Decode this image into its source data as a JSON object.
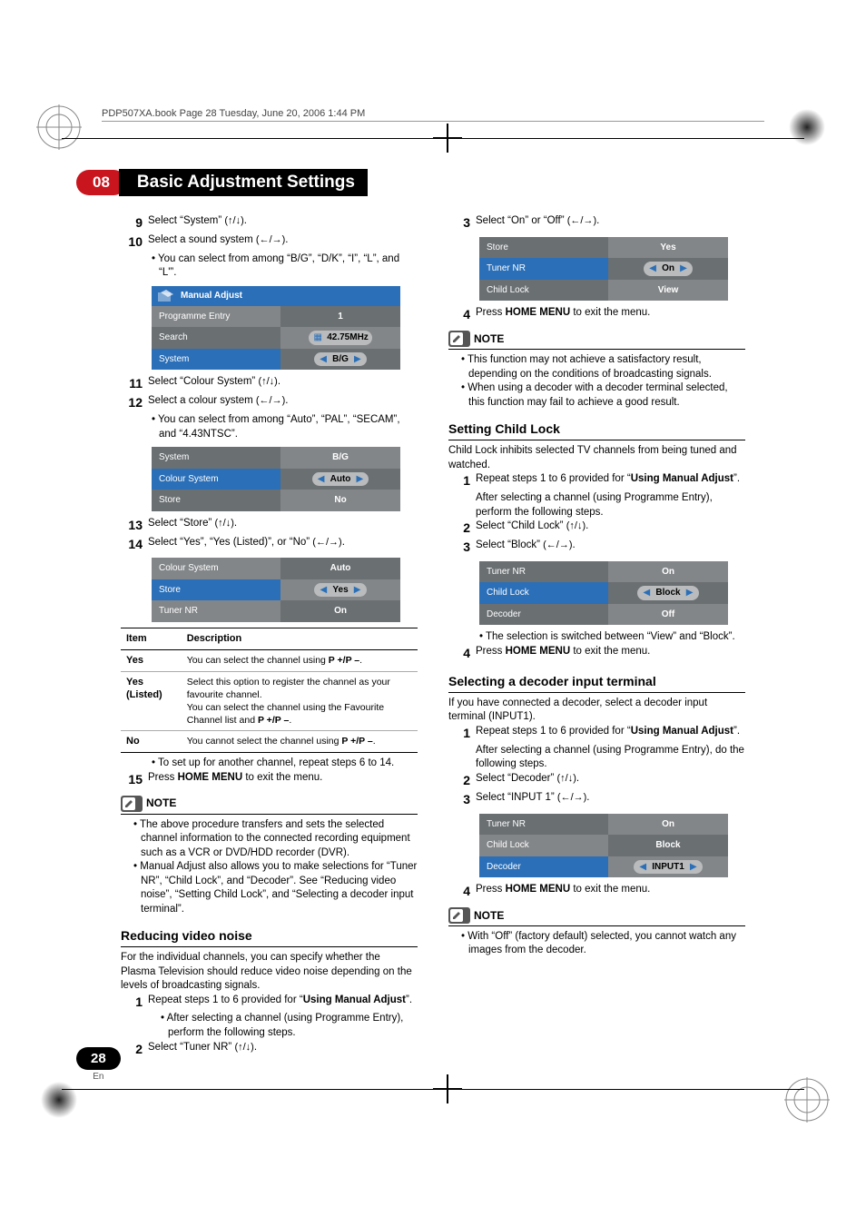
{
  "runhead": "PDP507XA.book  Page 28  Tuesday, June 20, 2006  1:44 PM",
  "chapter": {
    "num": "08",
    "title": "Basic Adjustment Settings"
  },
  "arrows": {
    "updown": "(↑/↓)",
    "leftright": "(←/→)"
  },
  "left": {
    "step9": "Select “System” ",
    "step10": "Select a sound system ",
    "step10_note": "You can select from among “B/G”, “D/K”, “I”, “L”, and “L'”.",
    "menu1": {
      "title": "Manual Adjust",
      "rows": [
        {
          "l": "Programme Entry",
          "r": "1"
        },
        {
          "l": "Search",
          "r": "42.75MHz"
        },
        {
          "l": "System",
          "r": "B/G",
          "hl": true,
          "pill": true
        }
      ]
    },
    "step11": "Select “Colour System” ",
    "step12": "Select a colour system ",
    "step12_note": "You can select from among “Auto”, “PAL”, “SECAM”, and “4.43NTSC”.",
    "menu2": {
      "rows": [
        {
          "l": "System",
          "r": "B/G"
        },
        {
          "l": "Colour System",
          "r": "Auto",
          "hl": true,
          "pill": true
        },
        {
          "l": "Store",
          "r": "No"
        }
      ]
    },
    "step13": "Select “Store” ",
    "step14": "Select “Yes”, “Yes (Listed)”, or “No” ",
    "menu3": {
      "rows": [
        {
          "l": "Colour System",
          "r": "Auto"
        },
        {
          "l": "Store",
          "r": "Yes",
          "hl": true,
          "pill": true
        },
        {
          "l": "Tuner NR",
          "r": "On"
        }
      ]
    },
    "idtable": {
      "hdr_item": "Item",
      "hdr_desc": "Description",
      "rows": [
        {
          "k": "Yes",
          "v": "You can select the channel using <b>P +/P –</b>."
        },
        {
          "k": "Yes (Listed)",
          "v": "Select this option to register the channel as your favourite channel.<br>You can select the channel using the Favourite Channel list and <b>P +/P –</b>."
        },
        {
          "k": "No",
          "v": "You cannot select the channel using <b>P +/P –</b>."
        }
      ]
    },
    "after_table_bullet": "To set up for another channel, repeat steps 6 to 14.",
    "step15_a": "Press ",
    "step15_b": "HOME MENU",
    "step15_c": " to exit the menu.",
    "note_label": "NOTE",
    "n1": "The above procedure transfers and sets the selected channel information to the connected recording equipment such as a VCR or DVD/HDD recorder (DVR).",
    "n2": "Manual Adjust also allows you to make selections for “Tuner NR”, “Child Lock”, and “Decoder”. See “Reducing video noise”, “Setting Child Lock”, and “Selecting a decoder input terminal”.",
    "sec_noise": "Reducing video noise",
    "sec_noise_body": "For the individual channels, you can specify whether the Plasma Television should reduce video noise depending on the levels of broadcasting signals.",
    "rn_s1_a": "Repeat steps 1 to 6 provided for “",
    "rn_s1_b": "Using Manual Adjust",
    "rn_s1_c": "”.",
    "rn_s1_sub": "After selecting a channel (using Programme Entry), perform the following steps.",
    "rn_s2": "Select “Tuner NR” "
  },
  "right": {
    "r_s3": "Select “On” or “Off” ",
    "menu4": {
      "rows": [
        {
          "l": "Store",
          "r": "Yes"
        },
        {
          "l": "Tuner NR",
          "r": "On",
          "hl": true,
          "pill": true
        },
        {
          "l": "Child Lock",
          "r": "View"
        }
      ]
    },
    "r_s4_a": "Press ",
    "r_s4_b": "HOME MENU",
    "r_s4_c": " to exit the menu.",
    "note_label": "NOTE",
    "rn1": "This function may not achieve a satisfactory result, depending on the conditions of broadcasting signals.",
    "rn2": "When using a decoder with a decoder terminal selected, this function may fail to achieve a good result.",
    "sec_cl": "Setting Child Lock",
    "sec_cl_body": "Child Lock inhibits selected TV channels from being tuned and watched.",
    "cl_s1_a": "Repeat steps 1 to 6 provided for “",
    "cl_s1_b": "Using Manual Adjust",
    "cl_s1_c": "”.",
    "cl_s1_sub": "After selecting a channel (using Programme Entry), perform the following steps.",
    "cl_s2": "Select “Child Lock” ",
    "cl_s3": "Select “Block” ",
    "menu5": {
      "rows": [
        {
          "l": "Tuner NR",
          "r": "On"
        },
        {
          "l": "Child Lock",
          "r": "Block",
          "hl": true,
          "pill": true
        },
        {
          "l": "Decoder",
          "r": "Off"
        }
      ]
    },
    "cl_bullet": "The selection is switched between “View” and “Block”.",
    "cl_s4_a": "Press ",
    "cl_s4_b": "HOME MENU",
    "cl_s4_c": " to exit the menu.",
    "sec_dec": "Selecting a decoder input terminal",
    "sec_dec_body": "If you have connected a decoder, select a decoder input terminal (INPUT1).",
    "dec_s1_a": "Repeat steps 1 to 6 provided for “",
    "dec_s1_b": "Using Manual Adjust",
    "dec_s1_c": "”.",
    "dec_s1_sub": "After selecting a channel (using Programme Entry), do the following steps.",
    "dec_s2": "Select “Decoder” ",
    "dec_s3": "Select “INPUT 1” ",
    "menu6": {
      "rows": [
        {
          "l": "Tuner NR",
          "r": "On"
        },
        {
          "l": "Child Lock",
          "r": "Block"
        },
        {
          "l": "Decoder",
          "r": "INPUT1",
          "hl": true,
          "pill": true
        }
      ]
    },
    "dec_s4_a": "Press ",
    "dec_s4_b": "HOME MENU",
    "dec_s4_c": " to exit the menu.",
    "dn1": "With “Off” (factory default) selected, you cannot watch any images from the decoder."
  },
  "footer": {
    "page": "28",
    "lang": "En"
  }
}
